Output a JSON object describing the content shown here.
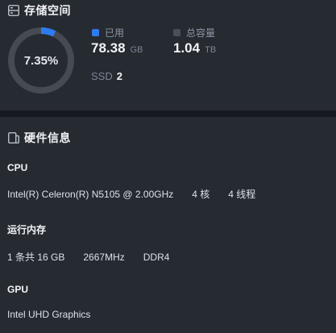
{
  "storage": {
    "title": "存储空间",
    "icon": "storage-icon",
    "percent_label": "7.35%",
    "percent_value": 7.35,
    "used": {
      "label": "已用",
      "value": "78.38",
      "unit": "GB",
      "color": "#2f7bf0"
    },
    "total": {
      "label": "总容量",
      "value": "1.04",
      "unit": "TB",
      "color": "#4a4f58"
    },
    "ssd": {
      "label": "SSD",
      "count": "2"
    },
    "colors": {
      "ring_track": "#454a53",
      "ring_fill": "#2f7bf0"
    }
  },
  "hardware": {
    "title": "硬件信息",
    "icon": "hardware-icon",
    "cpu": {
      "title": "CPU",
      "model": "Intel(R) Celeron(R) N5105 @ 2.00GHz",
      "cores": "4 核",
      "threads": "4 线程"
    },
    "memory": {
      "title": "运行内存",
      "modules": "1 条共 16 GB",
      "speed": "2667MHz",
      "type": "DDR4"
    },
    "gpu": {
      "title": "GPU",
      "model": "Intel UHD Graphics"
    }
  }
}
